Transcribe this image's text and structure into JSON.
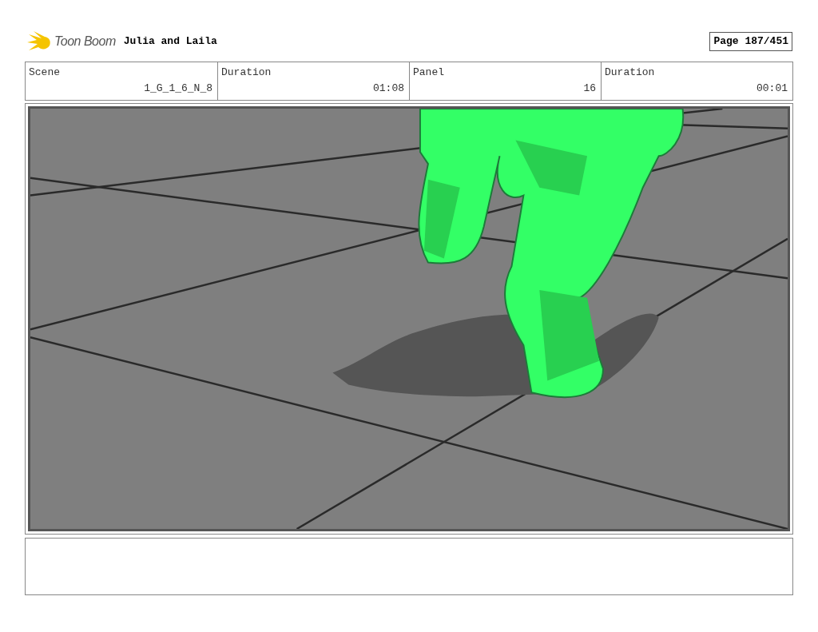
{
  "header": {
    "logo_text": "Toon Boom",
    "project_title": "Julia and Laila",
    "page": "Page 187/451"
  },
  "info": [
    {
      "label": "Scene",
      "value": "1_G_1_6_N_8"
    },
    {
      "label": "Duration",
      "value": "01:08"
    },
    {
      "label": "Panel",
      "value": "16"
    },
    {
      "label": "Duration",
      "value": "00:01"
    }
  ]
}
